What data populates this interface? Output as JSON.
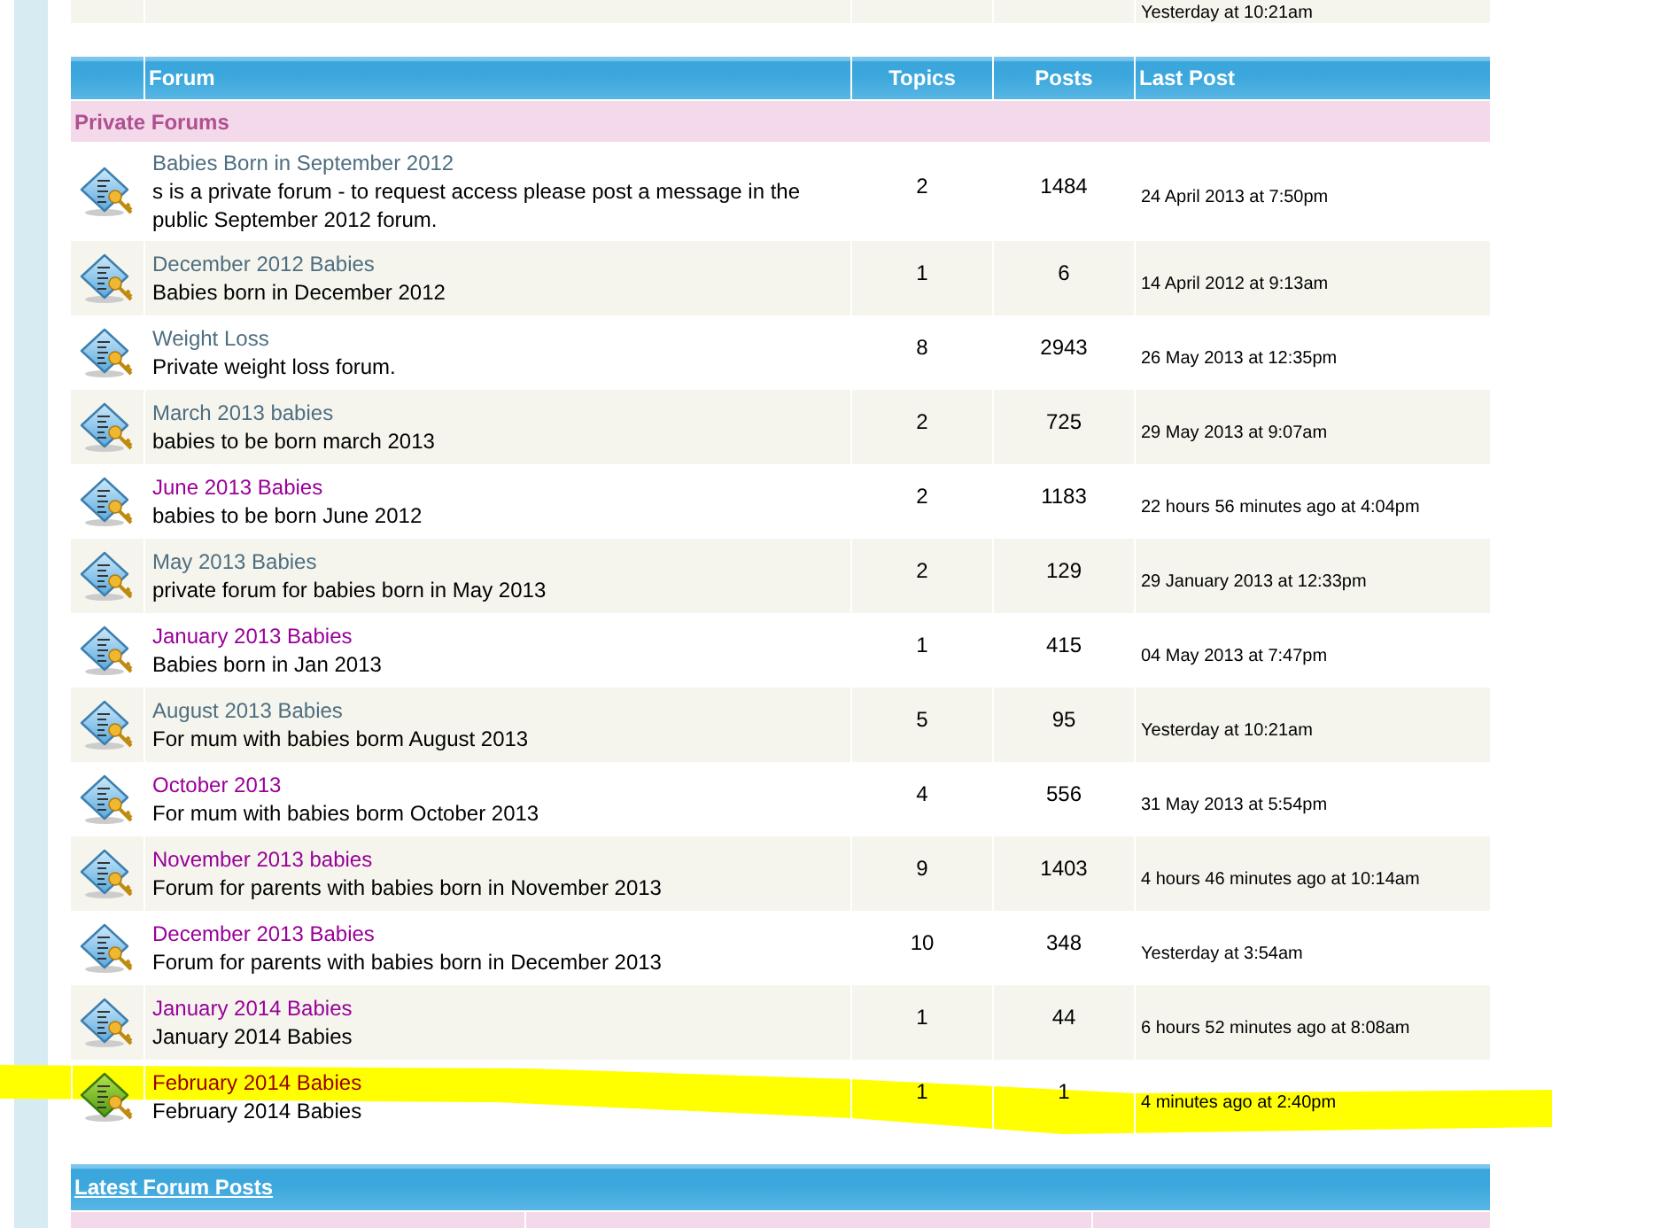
{
  "previous_row": {
    "last_post": "Yesterday at 10:21am"
  },
  "forum_table": {
    "columns": [
      "Forum",
      "Topics",
      "Posts",
      "Last Post"
    ],
    "category": "Private Forums",
    "rows": [
      {
        "name": "Babies Born in September 2012",
        "description": "s is a private forum - to request access please post a message in the public September 2012 forum.",
        "topics": "2",
        "posts": "1484",
        "last_post": "24 April 2013 at 7:50pm",
        "visited": false,
        "new_posts": false,
        "highlighted": false
      },
      {
        "name": "December 2012 Babies",
        "description": "Babies born in December 2012",
        "topics": "1",
        "posts": "6",
        "last_post": "14 April 2012 at 9:13am",
        "visited": false,
        "new_posts": false,
        "highlighted": false
      },
      {
        "name": "Weight Loss",
        "description": "Private weight loss forum.",
        "topics": "8",
        "posts": "2943",
        "last_post": "26 May 2013 at 12:35pm",
        "visited": false,
        "new_posts": false,
        "highlighted": false
      },
      {
        "name": "March 2013 babies",
        "description": "babies to be born march 2013",
        "topics": "2",
        "posts": "725",
        "last_post": "29 May 2013 at 9:07am",
        "visited": false,
        "new_posts": false,
        "highlighted": false
      },
      {
        "name": "June 2013 Babies",
        "description": "babies to be born June 2012",
        "topics": "2",
        "posts": "1183",
        "last_post": "22 hours 56 minutes ago at 4:04pm",
        "visited": true,
        "new_posts": false,
        "highlighted": false
      },
      {
        "name": "May 2013 Babies",
        "description": "private forum for babies born in May 2013",
        "topics": "2",
        "posts": "129",
        "last_post": "29 January 2013 at 12:33pm",
        "visited": false,
        "new_posts": false,
        "highlighted": false
      },
      {
        "name": "January 2013 Babies",
        "description": "Babies born in Jan 2013",
        "topics": "1",
        "posts": "415",
        "last_post": "04 May 2013 at 7:47pm",
        "visited": true,
        "new_posts": false,
        "highlighted": false
      },
      {
        "name": "August 2013 Babies",
        "description": "For mum with babies borm August 2013",
        "topics": "5",
        "posts": "95",
        "last_post": "Yesterday at 10:21am",
        "visited": false,
        "new_posts": false,
        "highlighted": false
      },
      {
        "name": "October 2013",
        "description": "For mum with babies borm October 2013",
        "topics": "4",
        "posts": "556",
        "last_post": "31 May 2013 at 5:54pm",
        "visited": true,
        "new_posts": false,
        "highlighted": false
      },
      {
        "name": "November 2013 babies",
        "description": "Forum for parents with babies born in November 2013",
        "topics": "9",
        "posts": "1403",
        "last_post": "4 hours 46 minutes ago at 10:14am",
        "visited": true,
        "new_posts": false,
        "highlighted": false
      },
      {
        "name": "December 2013 Babies",
        "description": "Forum for parents with babies born in December 2013",
        "topics": "10",
        "posts": "348",
        "last_post": "Yesterday at 3:54am",
        "visited": true,
        "new_posts": false,
        "highlighted": false
      },
      {
        "name": "January 2014 Babies",
        "description": "January 2014 Babies",
        "topics": "1",
        "posts": "44",
        "last_post": "6 hours 52 minutes ago at 8:08am",
        "visited": true,
        "new_posts": false,
        "highlighted": false
      },
      {
        "name": "February 2014 Babies",
        "description": "February 2014 Babies",
        "topics": "1",
        "posts": "1",
        "last_post": "4 minutes ago at 2:40pm",
        "visited": true,
        "new_posts": true,
        "highlighted": true
      }
    ]
  },
  "latest_posts": {
    "title": "Latest Forum Posts"
  }
}
